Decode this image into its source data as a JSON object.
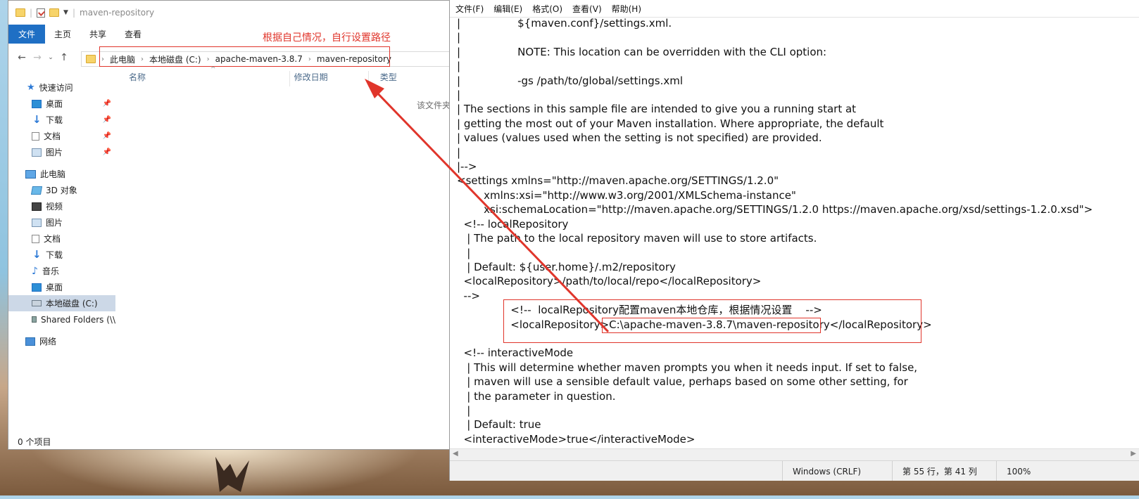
{
  "explorer": {
    "title": "maven-repository",
    "ribbon_tabs": [
      "文件",
      "主页",
      "共享",
      "查看"
    ],
    "annotation": "根据自己情况，自行设置路径",
    "breadcrumb": [
      "此电脑",
      "本地磁盘 (C:)",
      "apache-maven-3.8.7",
      "maven-repository"
    ],
    "columns": [
      "名称",
      "修改日期",
      "类型"
    ],
    "empty_text": "该文件夹",
    "nav": [
      {
        "label": "快速访问",
        "icon": "star-icon"
      },
      {
        "label": "桌面",
        "icon": "desktop-icon",
        "pinned": true
      },
      {
        "label": "下载",
        "icon": "download-icon",
        "pinned": true
      },
      {
        "label": "文档",
        "icon": "document-icon",
        "pinned": true
      },
      {
        "label": "图片",
        "icon": "picture-icon",
        "pinned": true
      },
      {
        "label": "此电脑",
        "icon": "computer-icon"
      },
      {
        "label": "3D 对象",
        "icon": "cube-icon"
      },
      {
        "label": "视频",
        "icon": "video-icon"
      },
      {
        "label": "图片",
        "icon": "picture-icon"
      },
      {
        "label": "文档",
        "icon": "document-icon"
      },
      {
        "label": "下载",
        "icon": "download-icon"
      },
      {
        "label": "音乐",
        "icon": "music-icon"
      },
      {
        "label": "桌面",
        "icon": "desktop-icon"
      },
      {
        "label": "本地磁盘 (C:)",
        "icon": "disk-icon",
        "selected": true
      },
      {
        "label": "Shared Folders (\\\\",
        "icon": "shared-folder-icon"
      },
      {
        "label": "网络",
        "icon": "network-icon"
      }
    ],
    "status": "0 个项目"
  },
  "notepad": {
    "menu": [
      "文件(F)",
      "编辑(E)",
      "格式(O)",
      "查看(V)",
      "帮助(H)"
    ],
    "lines": [
      "|                 ${maven.conf}/settings.xml.",
      "|",
      "|                 NOTE: This location can be overridden with the CLI option:",
      "|",
      "|                 -gs /path/to/global/settings.xml",
      "|",
      "| The sections in this sample file are intended to give you a running start at",
      "| getting the most out of your Maven installation. Where appropriate, the default",
      "| values (values used when the setting is not specified) are provided.",
      "|",
      "|-->",
      "<settings xmlns=\"http://maven.apache.org/SETTINGS/1.2.0\"",
      "        xmlns:xsi=\"http://www.w3.org/2001/XMLSchema-instance\"",
      "        xsi:schemaLocation=\"http://maven.apache.org/SETTINGS/1.2.0 https://maven.apache.org/xsd/settings-1.2.0.xsd\">",
      "  <!-- localRepository",
      "   | The path to the local repository maven will use to store artifacts.",
      "   |",
      "   | Default: ${user.home}/.m2/repository",
      "  <localRepository>/path/to/local/repo</localRepository>",
      "  -->",
      "                <!--  localRepository配置maven本地仓库，根据情况设置    -->",
      "                <localRepository>C:\\apache-maven-3.8.7\\maven-repository</localRepository>",
      "",
      "  <!-- interactiveMode",
      "   | This will determine whether maven prompts you when it needs input. If set to false,",
      "   | maven will use a sensible default value, perhaps based on some other setting, for",
      "   | the parameter in question.",
      "   |",
      "   | Default: true",
      "  <interactiveMode>true</interactiveMode>"
    ],
    "status": {
      "line_ending": "Windows (CRLF)",
      "position": "第 55 行，第 41 列",
      "zoom": "100%"
    }
  },
  "colors": {
    "annotation_red": "#e0352b",
    "ribbon_file_blue": "#1f6fc4"
  }
}
